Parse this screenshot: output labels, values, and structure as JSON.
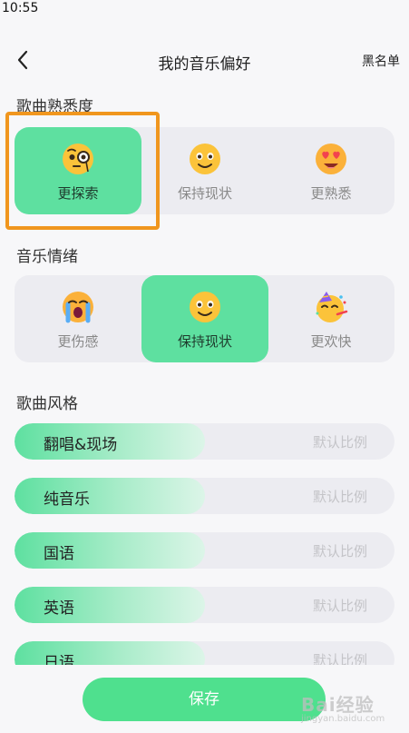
{
  "status_bar": {
    "time": "10:55"
  },
  "header": {
    "title": "我的音乐偏好",
    "blacklist_label": "黑名单"
  },
  "familiarity": {
    "title": "歌曲熟悉度",
    "options": [
      {
        "label": "更探索",
        "icon": "monocle-face-icon",
        "selected": true
      },
      {
        "label": "保持现状",
        "icon": "smiling-face-icon",
        "selected": false
      },
      {
        "label": "更熟悉",
        "icon": "heart-eyes-face-icon",
        "selected": false
      }
    ]
  },
  "mood": {
    "title": "音乐情绪",
    "options": [
      {
        "label": "更伤感",
        "icon": "crying-face-icon",
        "selected": false
      },
      {
        "label": "保持现状",
        "icon": "smiling-face-icon",
        "selected": true
      },
      {
        "label": "更欢快",
        "icon": "partying-face-icon",
        "selected": false
      }
    ]
  },
  "style": {
    "title": "歌曲风格",
    "rows": [
      {
        "name": "翻唱&现场",
        "ratio_label": "默认比例",
        "level": 0.5
      },
      {
        "name": "纯音乐",
        "ratio_label": "默认比例",
        "level": 0.5
      },
      {
        "name": "国语",
        "ratio_label": "默认比例",
        "level": 0.5
      },
      {
        "name": "英语",
        "ratio_label": "默认比例",
        "level": 0.5
      },
      {
        "name": "日语",
        "ratio_label": "默认比例",
        "level": 0.5
      }
    ]
  },
  "footer": {
    "save_label": "保存"
  },
  "watermark": {
    "text": "Bai经验",
    "sub": "jingyan.baidu.com"
  },
  "colors": {
    "accent": "#5ee0a0",
    "save_button": "#4fe08e",
    "highlight": "#f0961e"
  }
}
